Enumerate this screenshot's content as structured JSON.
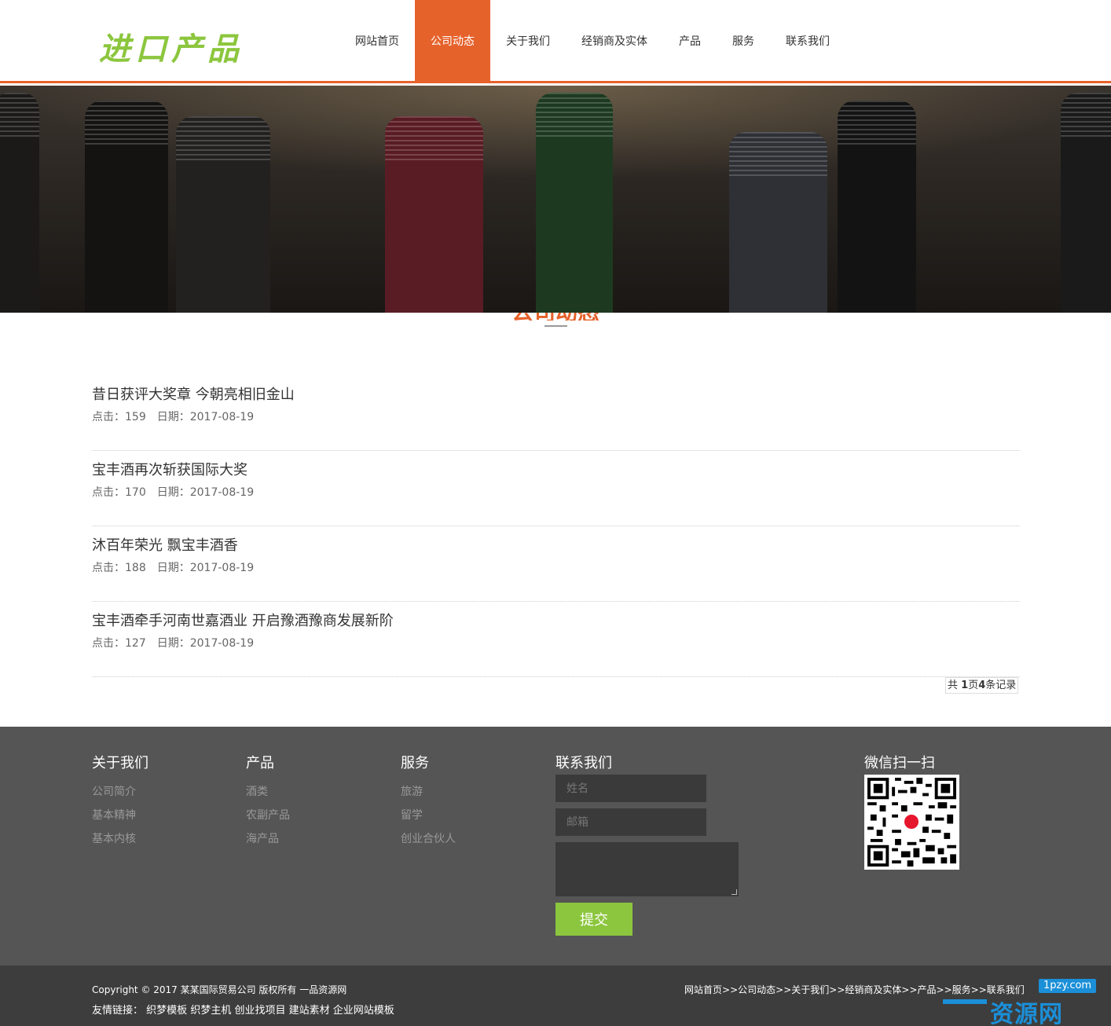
{
  "header": {
    "logo_text": "进口产品",
    "nav": [
      {
        "label": "网站首页",
        "active": false
      },
      {
        "label": "公司动态",
        "active": true
      },
      {
        "label": "关于我们",
        "active": false
      },
      {
        "label": "经销商及实体",
        "active": false
      },
      {
        "label": "产品",
        "active": false
      },
      {
        "label": "服务",
        "active": false
      },
      {
        "label": "联系我们",
        "active": false
      }
    ]
  },
  "section": {
    "title": "公司动态"
  },
  "news": [
    {
      "title": "昔日获评大奖章 今朝亮相旧金山",
      "clicks": "点击：159",
      "date": "日期：2017-08-19"
    },
    {
      "title": "宝丰酒再次斩获国际大奖",
      "clicks": "点击：170",
      "date": "日期：2017-08-19"
    },
    {
      "title": "沐百年荣光 飘宝丰酒香",
      "clicks": "点击：188",
      "date": "日期：2017-08-19"
    },
    {
      "title": "宝丰酒牵手河南世嘉酒业 开启豫酒豫商发展新阶",
      "clicks": "点击：127",
      "date": "日期：2017-08-19"
    }
  ],
  "pager": {
    "prefix": "共 ",
    "pages": "1",
    "mid": "页",
    "records": "4",
    "suffix": "条记录"
  },
  "footer": {
    "about": {
      "title": "关于我们",
      "links": [
        "公司简介",
        "基本精神",
        "基本内核"
      ]
    },
    "products": {
      "title": "产品",
      "links": [
        "酒类",
        "农副产品",
        "海产品"
      ]
    },
    "services": {
      "title": "服务",
      "links": [
        "旅游",
        "留学",
        "创业合伙人"
      ]
    },
    "contact": {
      "title": "联系我们",
      "name_placeholder": "姓名",
      "email_placeholder": "邮箱",
      "submit_label": "提交"
    },
    "wechat": {
      "title": "微信扫一扫"
    }
  },
  "copyright": {
    "text": "Copyright © 2017 某某国际贸易公司 版权所有  一品资源网",
    "friend_links_label": "友情链接：",
    "friend_links": [
      "织梦模板",
      "织梦主机",
      "创业找项目",
      "建站素材",
      "企业网站模板"
    ],
    "crumbs": [
      "网站首页",
      "公司动态",
      "关于我们",
      "经销商及实体",
      "产品",
      "服务",
      "联系我们"
    ],
    "crumb_sep": ">>"
  },
  "watermark": {
    "tag": "1pzy.com",
    "text": "资源网"
  },
  "colors": {
    "accent": "#e6622b",
    "green": "#8cc63e",
    "footer_bg": "#555555",
    "copy_bg": "#3d3d3d"
  }
}
